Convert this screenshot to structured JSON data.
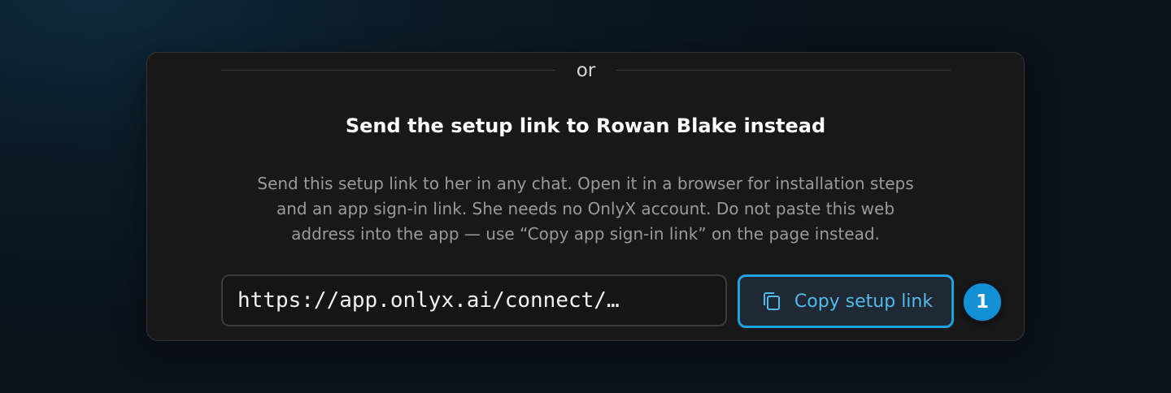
{
  "divider": {
    "label": "or"
  },
  "panel": {
    "title": "Send the setup link to Rowan Blake instead",
    "description": [
      "Send this setup link to her in any chat. Open it in a browser for installation steps",
      "and an app sign-in link. She needs no OnlyX account. Do not paste this web",
      "address into the app — use “Copy app sign-in link” on the page instead."
    ],
    "url_value": "https://app.onlyx.ai/connect/…",
    "copy_button": {
      "label": "Copy setup link",
      "icon": "copy-icon"
    },
    "step_badge": "1"
  },
  "colors": {
    "accent": "#1ea2e0",
    "accent_text": "#52b9ee",
    "badge": "#1491d6",
    "card_bg": "#181818"
  }
}
